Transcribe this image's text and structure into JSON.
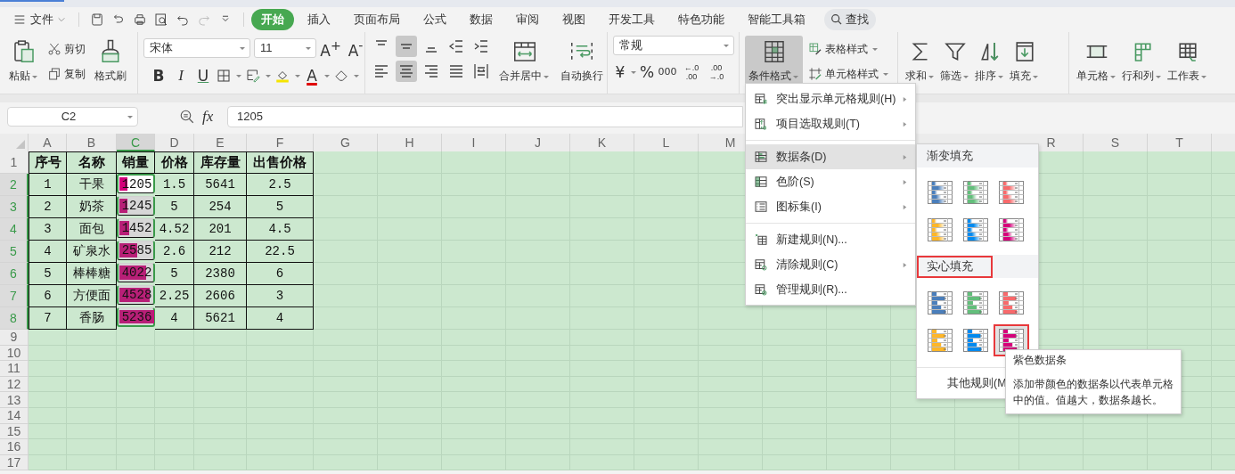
{
  "menu_bar": {
    "file_menu": "文件"
  },
  "tabs": [
    {
      "label": "开始",
      "selected": true
    },
    {
      "label": "插入",
      "selected": false
    },
    {
      "label": "页面布局",
      "selected": false
    },
    {
      "label": "公式",
      "selected": false
    },
    {
      "label": "数据",
      "selected": false
    },
    {
      "label": "审阅",
      "selected": false
    },
    {
      "label": "视图",
      "selected": false
    },
    {
      "label": "开发工具",
      "selected": false
    },
    {
      "label": "特色功能",
      "selected": false
    },
    {
      "label": "智能工具箱",
      "selected": false
    }
  ],
  "search": {
    "label": "查找"
  },
  "ribbon": {
    "clipboard": {
      "paste": "粘贴",
      "cut": "剪切",
      "copy": "复制",
      "format_painter": "格式刷"
    },
    "font": {
      "family": "宋体",
      "size": "11",
      "grow": "A$^{+}$",
      "shrink": "A$^{-}$",
      "bold": "B",
      "italic": "I",
      "underline": "U",
      "font_color": "A"
    },
    "alignment": {
      "buttons": [
        {
          "selected": false
        },
        {
          "selected": true
        },
        {
          "selected": false
        },
        {
          "selected": false
        },
        {
          "selected": false
        },
        {
          "selected": false
        },
        {
          "selected": true
        },
        {
          "selected": false
        },
        {
          "selected": false
        },
        {
          "selected": false
        }
      ],
      "merge": "合并居中",
      "wrap": "自动换行"
    },
    "number": {
      "format": "常规",
      "currency": "¥",
      "percent": "%",
      "thousands": "000",
      "decimals": [
        [
          "←.0",
          ".00"
        ],
        [
          ".00",
          "→.0"
        ]
      ]
    },
    "styles": {
      "conditional": {
        "label": "条件格式",
        "selected": true
      },
      "table_style": "表格样式",
      "cell_style": "单元格样式"
    },
    "editing": [
      "求和",
      "筛选",
      "排序",
      "填充"
    ],
    "cells": [
      "单元格",
      "行和列",
      "工作表"
    ]
  },
  "formula_bar": {
    "name_box": "C2",
    "function_label": "fx",
    "value": "1205"
  },
  "sheet": {
    "columns_left": [
      {
        "label": "A",
        "selected": false
      },
      {
        "label": "B",
        "selected": false
      },
      {
        "label": "C",
        "selected": true
      },
      {
        "label": "D",
        "selected": false
      },
      {
        "label": "E",
        "selected": false
      },
      {
        "label": "F",
        "selected": false
      },
      {
        "label": "G",
        "selected": false
      },
      {
        "label": "H",
        "selected": false
      },
      {
        "label": "I",
        "selected": false
      },
      {
        "label": "J",
        "selected": false
      },
      {
        "label": "K",
        "selected": false
      },
      {
        "label": "L",
        "selected": false
      },
      {
        "label": "M",
        "selected": false
      }
    ],
    "columns_right": [
      {
        "label": "R",
        "selected": false
      },
      {
        "label": "S",
        "selected": false
      },
      {
        "label": "T",
        "selected": false
      }
    ],
    "rows": [
      {
        "header": "1",
        "kind": "heading",
        "selected": false,
        "cells": [
          {
            "text": "序号"
          },
          {
            "text": "名称"
          },
          {
            "text": "销量"
          },
          {
            "text": "价格"
          },
          {
            "text": "库存量"
          },
          {
            "text": "出售价格"
          }
        ]
      },
      {
        "header": "2",
        "kind": "data",
        "selected": true,
        "cells": [
          {
            "text": "1"
          },
          {
            "text": "干果"
          },
          {
            "text": "1205",
            "level": 0.22,
            "active": true
          },
          {
            "text": "1.5"
          },
          {
            "text": "5641"
          },
          {
            "text": "2.5"
          }
        ]
      },
      {
        "header": "3",
        "kind": "data",
        "selected": true,
        "cells": [
          {
            "text": "2"
          },
          {
            "text": "奶茶"
          },
          {
            "text": "1245",
            "level": 0.23,
            "active": false
          },
          {
            "text": "5"
          },
          {
            "text": "254"
          },
          {
            "text": "5"
          }
        ]
      },
      {
        "header": "4",
        "kind": "data",
        "selected": true,
        "cells": [
          {
            "text": "3"
          },
          {
            "text": "面包"
          },
          {
            "text": "1452",
            "level": 0.28,
            "active": false
          },
          {
            "text": "4.52"
          },
          {
            "text": "201"
          },
          {
            "text": "4.5"
          }
        ]
      },
      {
        "header": "5",
        "kind": "data",
        "selected": true,
        "cells": [
          {
            "text": "4"
          },
          {
            "text": "矿泉水"
          },
          {
            "text": "2585",
            "level": 0.5,
            "active": false
          },
          {
            "text": "2.6"
          },
          {
            "text": "212"
          },
          {
            "text": "22.5"
          }
        ]
      },
      {
        "header": "6",
        "kind": "data",
        "selected": true,
        "cells": [
          {
            "text": "5"
          },
          {
            "text": "棒棒糖"
          },
          {
            "text": "4022",
            "level": 0.78,
            "active": false
          },
          {
            "text": "5"
          },
          {
            "text": "2380"
          },
          {
            "text": "6"
          }
        ]
      },
      {
        "header": "7",
        "kind": "data",
        "selected": true,
        "cells": [
          {
            "text": "6"
          },
          {
            "text": "方便面"
          },
          {
            "text": "4528",
            "level": 0.88,
            "active": false
          },
          {
            "text": "2.25"
          },
          {
            "text": "2606"
          },
          {
            "text": "3"
          }
        ]
      },
      {
        "header": "8",
        "kind": "data",
        "selected": true,
        "cells": [
          {
            "text": "7"
          },
          {
            "text": "香肠"
          },
          {
            "text": "5236",
            "level": 1,
            "active": false
          },
          {
            "text": "4"
          },
          {
            "text": "5621"
          },
          {
            "text": "4"
          }
        ]
      },
      {
        "header": "9",
        "kind": "empty",
        "selected": false
      },
      {
        "header": "10",
        "kind": "empty",
        "selected": false
      },
      {
        "header": "11",
        "kind": "empty",
        "selected": false
      },
      {
        "header": "12",
        "kind": "empty",
        "selected": false
      },
      {
        "header": "13",
        "kind": "empty",
        "selected": false
      },
      {
        "header": "14",
        "kind": "empty",
        "selected": false
      },
      {
        "header": "15",
        "kind": "empty",
        "selected": false
      },
      {
        "header": "16",
        "kind": "empty",
        "selected": false
      },
      {
        "header": "17",
        "kind": "empty",
        "selected": false
      }
    ]
  },
  "conditional_menu": {
    "groups": [
      [
        {
          "label": "突出显示单元格规则(H)",
          "submenu": true,
          "selected": false
        },
        {
          "label": "项目选取规则(T)",
          "submenu": true,
          "selected": false
        }
      ],
      [
        {
          "label": "数据条(D)",
          "submenu": true,
          "selected": true
        },
        {
          "label": "色阶(S)",
          "submenu": true,
          "selected": false
        },
        {
          "label": "图标集(I)",
          "submenu": true,
          "selected": false
        }
      ],
      [
        {
          "label": "新建规则(N)...",
          "submenu": false,
          "selected": false
        },
        {
          "label": "清除规则(C)",
          "submenu": true,
          "selected": false
        },
        {
          "label": "管理规则(R)...",
          "submenu": false,
          "selected": false
        }
      ]
    ]
  },
  "data_bar_menu": {
    "sections": [
      {
        "title": "渐变填充",
        "kind": "gradient",
        "outlined": false,
        "swatches": [
          {
            "color": "#4a7ebb",
            "selected": false
          },
          {
            "color": "#63be7b",
            "selected": false
          },
          {
            "color": "#f8696b",
            "selected": false
          },
          {
            "color": "#ffb628",
            "selected": false
          },
          {
            "color": "#008aef",
            "selected": false
          },
          {
            "color": "#d6007b",
            "selected": false
          }
        ]
      },
      {
        "title": "实心填充",
        "kind": "solid",
        "outlined": true,
        "swatches": [
          {
            "color": "#4a7ebb",
            "selected": false
          },
          {
            "color": "#63be7b",
            "selected": false
          },
          {
            "color": "#f8696b",
            "selected": false
          },
          {
            "color": "#ffb628",
            "selected": false
          },
          {
            "color": "#008aef",
            "selected": false
          },
          {
            "color": "#d6007b",
            "selected": true
          }
        ]
      }
    ],
    "footer": "其他规则(M"
  },
  "tooltip": {
    "title": "紫色数据条",
    "body": "添加带颜色的数据条以代表单元格中的值。值越大，数据条越长。"
  }
}
